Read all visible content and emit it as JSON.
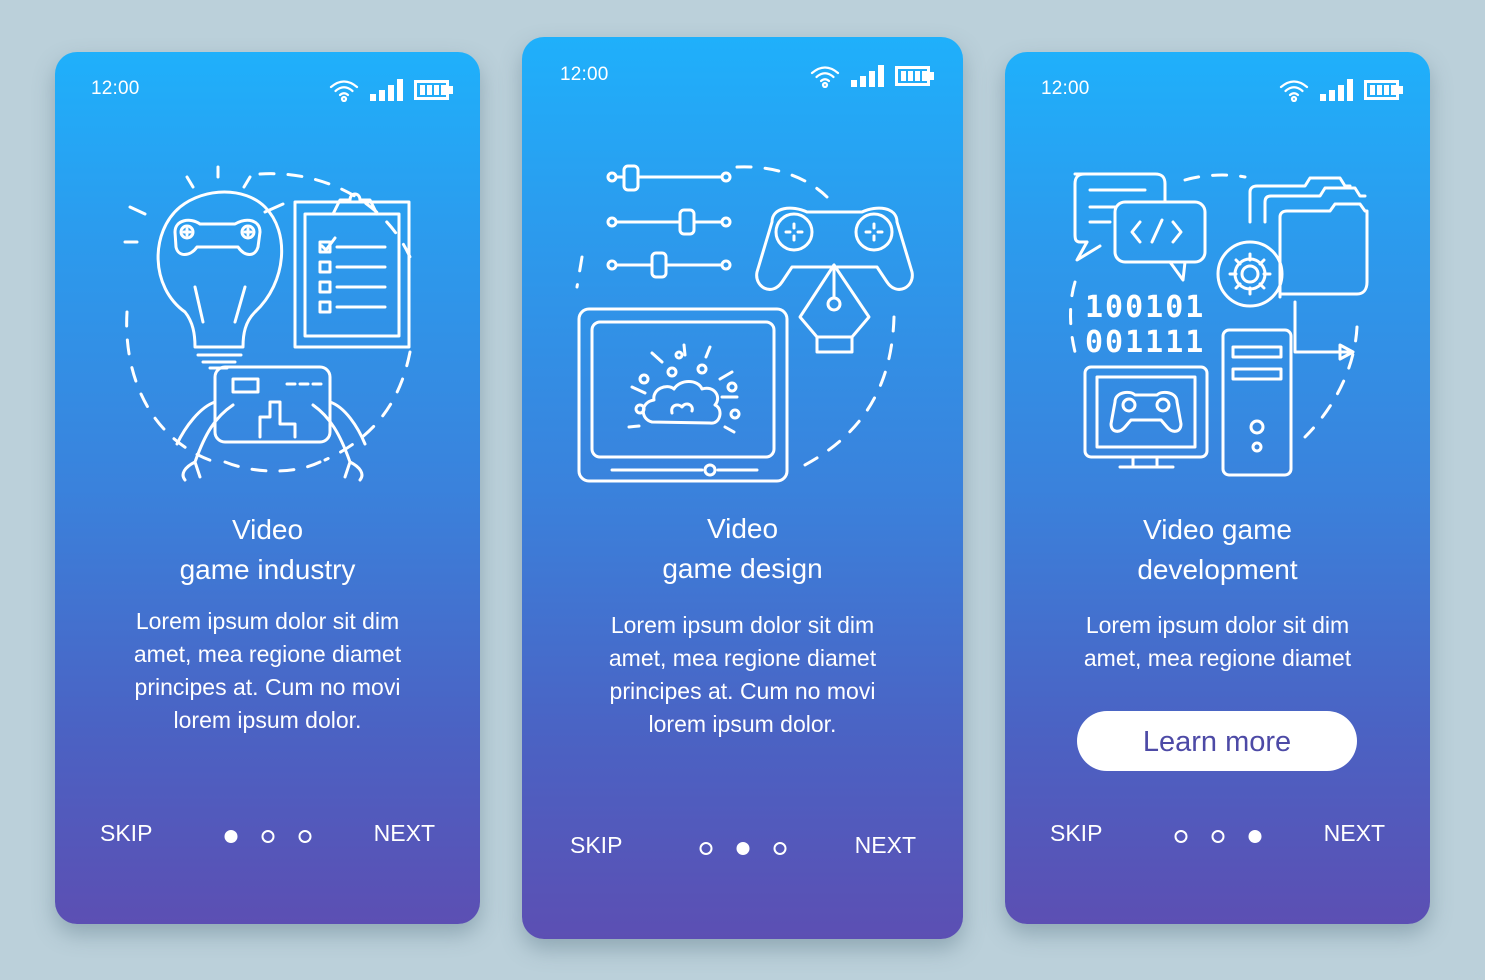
{
  "colors": {
    "background": "#bbd0da",
    "gradient_top": "#1fb0fb",
    "gradient_bottom": "#5c4fb3",
    "foreground": "#ffffff",
    "button_text": "#4d4aa6"
  },
  "screens": [
    {
      "status": {
        "time": "12:00",
        "icons": [
          "wifi-icon",
          "signal-icon",
          "battery-icon"
        ]
      },
      "illustration": [
        "lightbulb-gamepad-icon",
        "checklist-clipboard-icon",
        "hands-holding-phone-icon"
      ],
      "title_line1": "Video",
      "title_line2": "game industry",
      "body": [
        "Lorem ipsum dolor sit dim",
        "amet, mea regione diamet",
        "principes at. Cum no movi",
        "lorem ipsum dolor."
      ],
      "nav": {
        "skip": "SKIP",
        "next": "NEXT",
        "page": 1,
        "total_pages": 3
      }
    },
    {
      "status": {
        "time": "12:00",
        "icons": [
          "wifi-icon",
          "signal-icon",
          "battery-icon"
        ]
      },
      "illustration": [
        "sliders-icon",
        "gamepad-icon",
        "pen-nib-icon",
        "tablet-explosion-icon"
      ],
      "title_line1": "Video",
      "title_line2": "game design",
      "body": [
        "Lorem ipsum dolor sit dim",
        "amet, mea regione diamet",
        "principes at. Cum no movi",
        "lorem ipsum dolor."
      ],
      "nav": {
        "skip": "SKIP",
        "next": "NEXT",
        "page": 2,
        "total_pages": 3
      }
    },
    {
      "status": {
        "time": "12:00",
        "icons": [
          "wifi-icon",
          "signal-icon",
          "battery-icon"
        ]
      },
      "illustration": [
        "chat-code-icon",
        "folders-gear-icon",
        "binary-code-icon",
        "monitor-gamepad-icon",
        "pc-tower-icon"
      ],
      "binary_line1": "100101",
      "binary_line2": "001111",
      "code_glyph": "</>",
      "title_line1": "Video game",
      "title_line2": "development",
      "body": [
        "Lorem ipsum dolor sit dim",
        "amet, mea regione diamet"
      ],
      "cta": "Learn more",
      "nav": {
        "skip": "SKIP",
        "next": "NEXT",
        "page": 3,
        "total_pages": 3
      }
    }
  ]
}
